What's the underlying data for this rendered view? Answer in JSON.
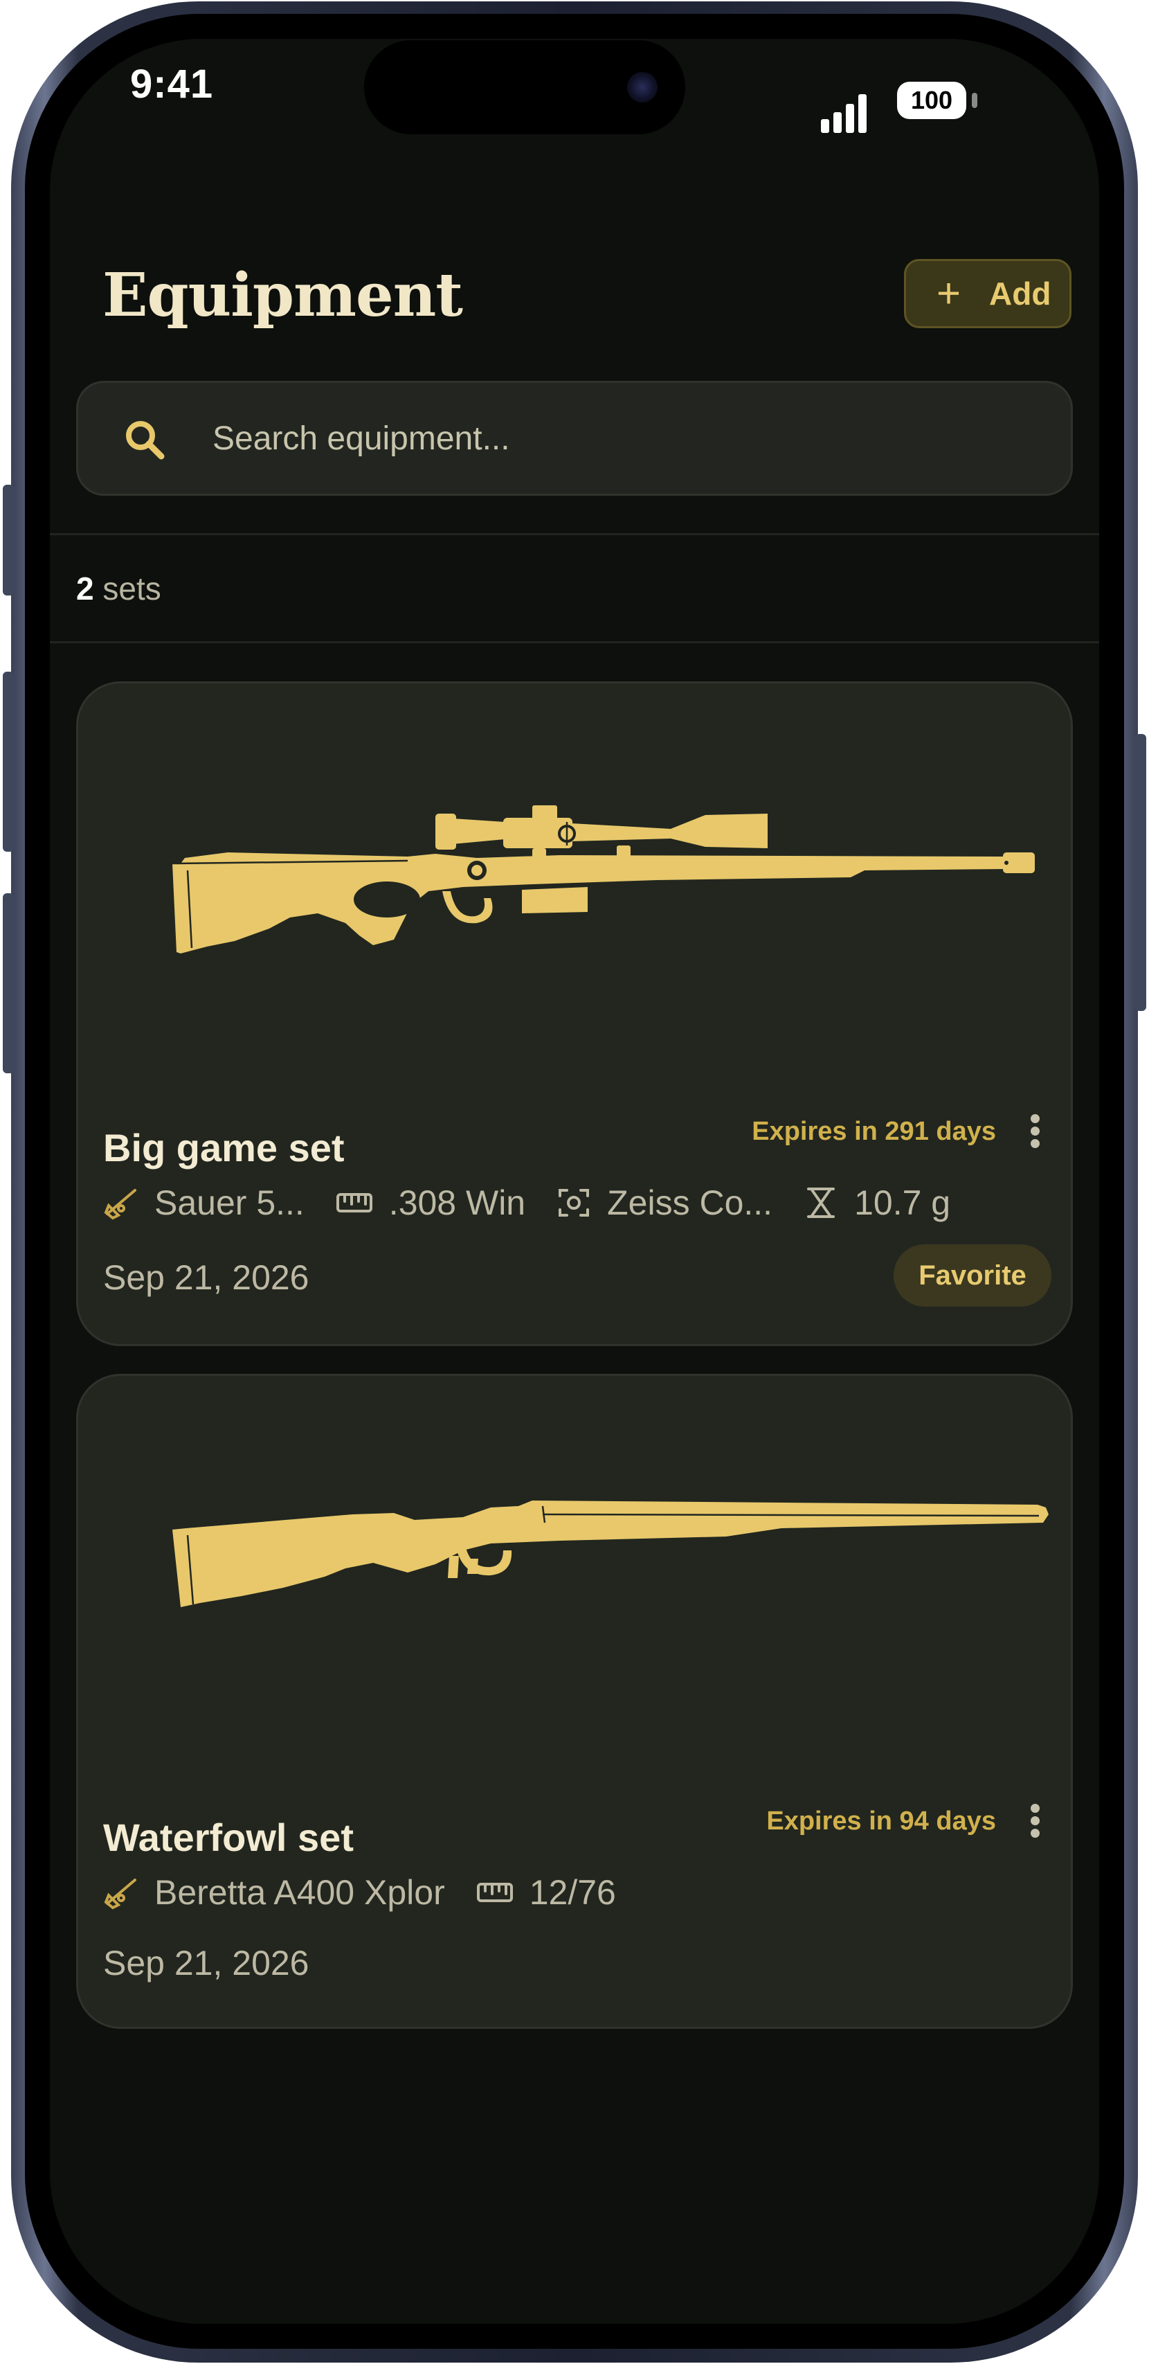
{
  "status_bar": {
    "time": "9:41",
    "battery": "100"
  },
  "header": {
    "title": "Equipment",
    "add_label": "Add"
  },
  "search": {
    "placeholder": "Search equipment..."
  },
  "summary": {
    "count": "2",
    "unit": "sets"
  },
  "cards": [
    {
      "name": "Big game set",
      "expiry": "Expires in 291 days",
      "weapon": "Sauer 5...",
      "caliber": ".308 Win",
      "optic": "Zeiss Co...",
      "weight": "10.7 g",
      "date": "Sep 21, 2026",
      "badge": "Favorite",
      "image": "bolt-action-rifle"
    },
    {
      "name": "Waterfowl set",
      "expiry": "Expires in 94 days",
      "weapon": "Beretta A400 Xplor",
      "caliber": "12/76",
      "date": "Sep 21, 2026",
      "image": "shotgun"
    }
  ],
  "colors": {
    "accent": "#e8c86b",
    "background": "#0d100c",
    "card": "#22261f",
    "title": "#f1e7c7"
  }
}
